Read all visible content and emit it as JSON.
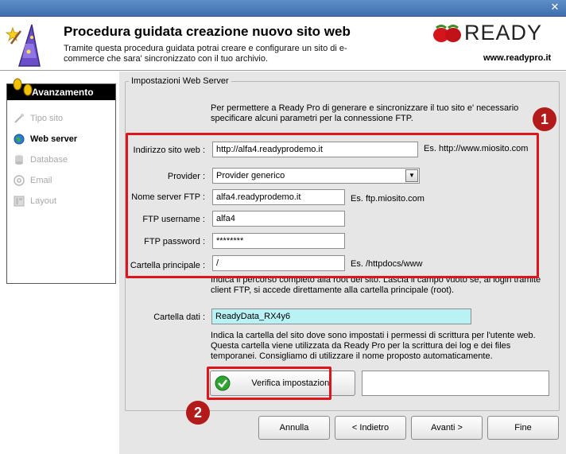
{
  "window": {
    "close_glyph": "✕"
  },
  "header": {
    "title": "Procedura guidata creazione nuovo sito web",
    "description": "Tramite questa procedura guidata potrai creare e configurare un sito di e-commerce che sara' sincronizzato con il tuo archivio.",
    "brand_name": "READY",
    "brand_url": "www.readypro.it",
    "icon": "wizard-hat-icon"
  },
  "sidebar": {
    "heading": "Avanzamento",
    "steps": [
      {
        "label": "Tipo sito",
        "icon": "wand-icon",
        "active": false
      },
      {
        "label": "Web server",
        "icon": "globe-icon",
        "active": true
      },
      {
        "label": "Database",
        "icon": "database-icon",
        "active": false
      },
      {
        "label": "Email",
        "icon": "email-icon",
        "active": false
      },
      {
        "label": "Layout",
        "icon": "layout-icon",
        "active": false
      }
    ]
  },
  "group": {
    "title": "Impostazioni Web Server",
    "intro": "Per permettere a Ready Pro di generare e sincronizzare il tuo sito e' necessario specificare alcuni parametri per la connessione FTP.",
    "fields": {
      "site_address": {
        "label": "Indirizzo sito web :",
        "value": "http://alfa4.readyprodemo.it",
        "hint": "Es. http://www.miosito.com"
      },
      "provider": {
        "label": "Provider :",
        "value": "Provider generico"
      },
      "ftp_server": {
        "label": "Nome server FTP :",
        "value": "alfa4.readyprodemo.it",
        "hint": "Es. ftp.miosito.com"
      },
      "ftp_username": {
        "label": "FTP username :",
        "value": "alfa4"
      },
      "ftp_password": {
        "label": "FTP password :",
        "value": "********"
      },
      "root_folder": {
        "label": "Cartella principale :",
        "value": "/",
        "hint": "Es. /httpdocs/www"
      },
      "data_folder": {
        "label": "Cartella dati :",
        "value": "ReadyData_RX4y6"
      }
    },
    "root_note": "Indica il percorso completo alla root del sito. Lascia il campo vuoto se, al login tramite client FTP, si accede direttamente alla cartella principale (root).",
    "data_note": "Indica la cartella del sito dove sono impostati i permessi di scrittura per l'utente web. Questa cartella viene utilizzata da Ready Pro per la scrittura dei log e dei files temporanei. Consigliamo di utilizzare il nome proposto automaticamente.",
    "verify_label": "Verifica impostazioni",
    "verify_result": ""
  },
  "footer": {
    "cancel": "Annulla",
    "back": "< Indietro",
    "next": "Avanti >",
    "finish": "Fine"
  },
  "annotations": {
    "badge1": "1",
    "badge2": "2",
    "color": "#e0141b"
  }
}
